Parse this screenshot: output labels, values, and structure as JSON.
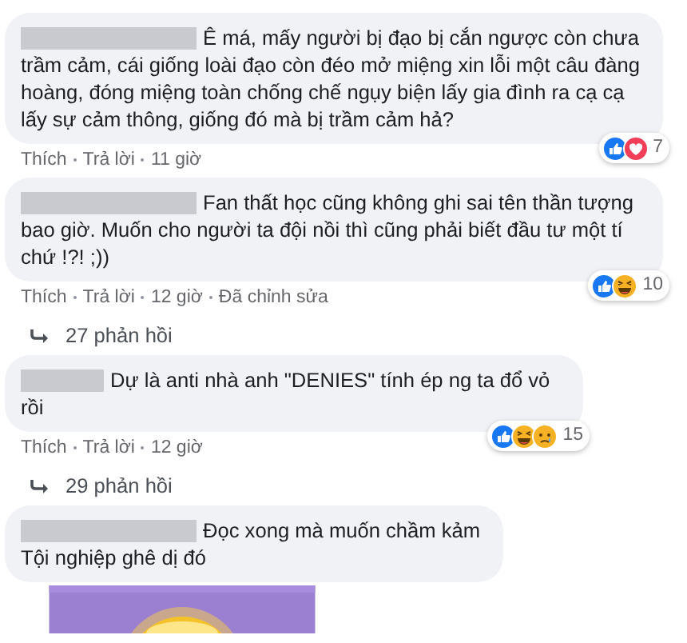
{
  "comments": [
    {
      "text": "Ê má, mấy người bị đạo bị cắn ngược còn chưa trầm cảm, cái giống loài đạo còn đéo mở miệng xin lỗi một câu đàng hoàng, đóng miệng toàn chống chế ngụy biện lấy gia đình ra cạ cạ lấy sự cảm thông, giống đó mà bị trầm cảm hả?",
      "actions": [
        "Thích",
        "Trả lời",
        "11 giờ"
      ],
      "reactions": {
        "icons": [
          {
            "kind": "like"
          },
          {
            "kind": "love"
          }
        ],
        "count": "7"
      }
    },
    {
      "text": "Fan thất học cũng không ghi sai tên thần tượng bao giờ. Muốn cho người ta đội nồi thì cũng phải biết đầu tư một tí chứ !?! ;))",
      "actions": [
        "Thích",
        "Trả lời",
        "12 giờ",
        "Đã chỉnh sửa"
      ],
      "reactions": {
        "icons": [
          {
            "kind": "like"
          },
          {
            "kind": "haha"
          }
        ],
        "count": "10"
      },
      "replies": "27 phản hồi"
    },
    {
      "text": "Dự là anti nhà anh \"DENIES\" tính ép ng ta đổ vỏ rồi",
      "actions": [
        "Thích",
        "Trả lời",
        "12 giờ"
      ],
      "reactions": {
        "icons": [
          {
            "kind": "like"
          },
          {
            "kind": "haha"
          },
          {
            "kind": "sad"
          }
        ],
        "count": "15"
      },
      "replies": "29 phản hồi"
    },
    {
      "text": "Đọc xong mà muốn chầm kảm Tội nghiệp ghê dị đó"
    }
  ]
}
